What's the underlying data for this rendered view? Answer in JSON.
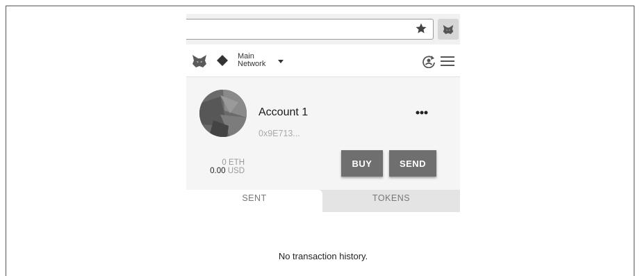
{
  "network": {
    "line1": "Main",
    "line2": "Network"
  },
  "account": {
    "name": "Account 1",
    "address": "0x9E713...",
    "balance_eth_amount": "0",
    "balance_eth_unit": "ETH",
    "balance_usd_amount": "0.00",
    "balance_usd_unit": "USD"
  },
  "buttons": {
    "buy": "BUY",
    "send": "SEND"
  },
  "tabs": [
    {
      "label": "SENT",
      "active": true
    },
    {
      "label": "TOKENS",
      "active": false
    }
  ],
  "transactions": {
    "empty_message": "No transaction history."
  },
  "icons": {
    "star": "star-icon",
    "extension": "fox-icon",
    "network": "diamond-icon",
    "sync": "sync-icon",
    "menu": "hamburger-menu-icon",
    "more": "more-dots-icon"
  },
  "colors": {
    "button_bg": "#6f6f6f",
    "account_bg": "#f5f5f5",
    "tab_inactive_bg": "#e4e4e4"
  }
}
